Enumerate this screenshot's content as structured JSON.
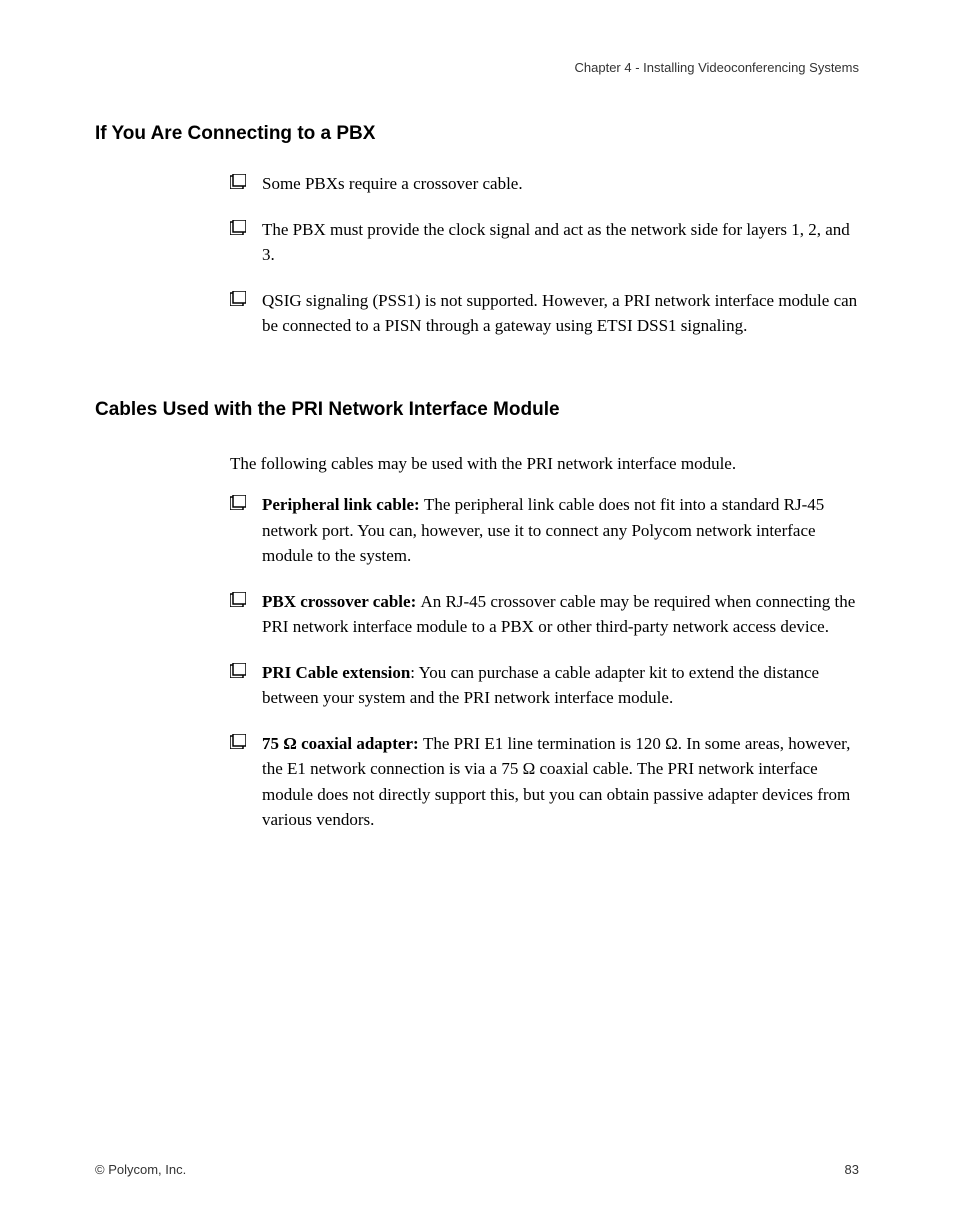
{
  "header": {
    "chapter_text": "Chapter 4 - Installing Videoconferencing Systems"
  },
  "section1": {
    "heading": "If You Are Connecting to a PBX",
    "items": [
      {
        "text": "Some PBXs require a crossover cable."
      },
      {
        "text": "The PBX must provide the clock signal and act as the network side for layers 1, 2, and 3."
      },
      {
        "text": "QSIG signaling (PSS1) is not supported. However, a PRI network interface module can be connected to a PISN through a gateway using ETSI DSS1 signaling."
      }
    ]
  },
  "section2": {
    "heading": "Cables Used with the PRI Network Interface Module",
    "intro": "The following cables may be used with the PRI network interface module.",
    "items": [
      {
        "bold": "Peripheral link cable: ",
        "text": "The peripheral link cable does not fit into a standard RJ-45 network port. You can, however, use it to connect any Polycom network interface module to the system."
      },
      {
        "bold": "PBX crossover cable: ",
        "text": "An RJ-45 crossover cable may be required when connecting the PRI network interface module to a PBX or other third-party network access device."
      },
      {
        "bold": "PRI Cable extension",
        "text": ": You can purchase a cable adapter kit to extend the distance between your system and the PRI network interface module."
      },
      {
        "bold": "75 Ω coaxial adapter: ",
        "text": "The PRI E1 line termination is 120 Ω. In some areas, however, the E1 network connection is via a 75 Ω coaxial cable. The PRI network interface module does not directly support this, but you can obtain passive adapter devices from various vendors."
      }
    ]
  },
  "footer": {
    "copyright": "© Polycom, Inc.",
    "page_number": "83"
  }
}
